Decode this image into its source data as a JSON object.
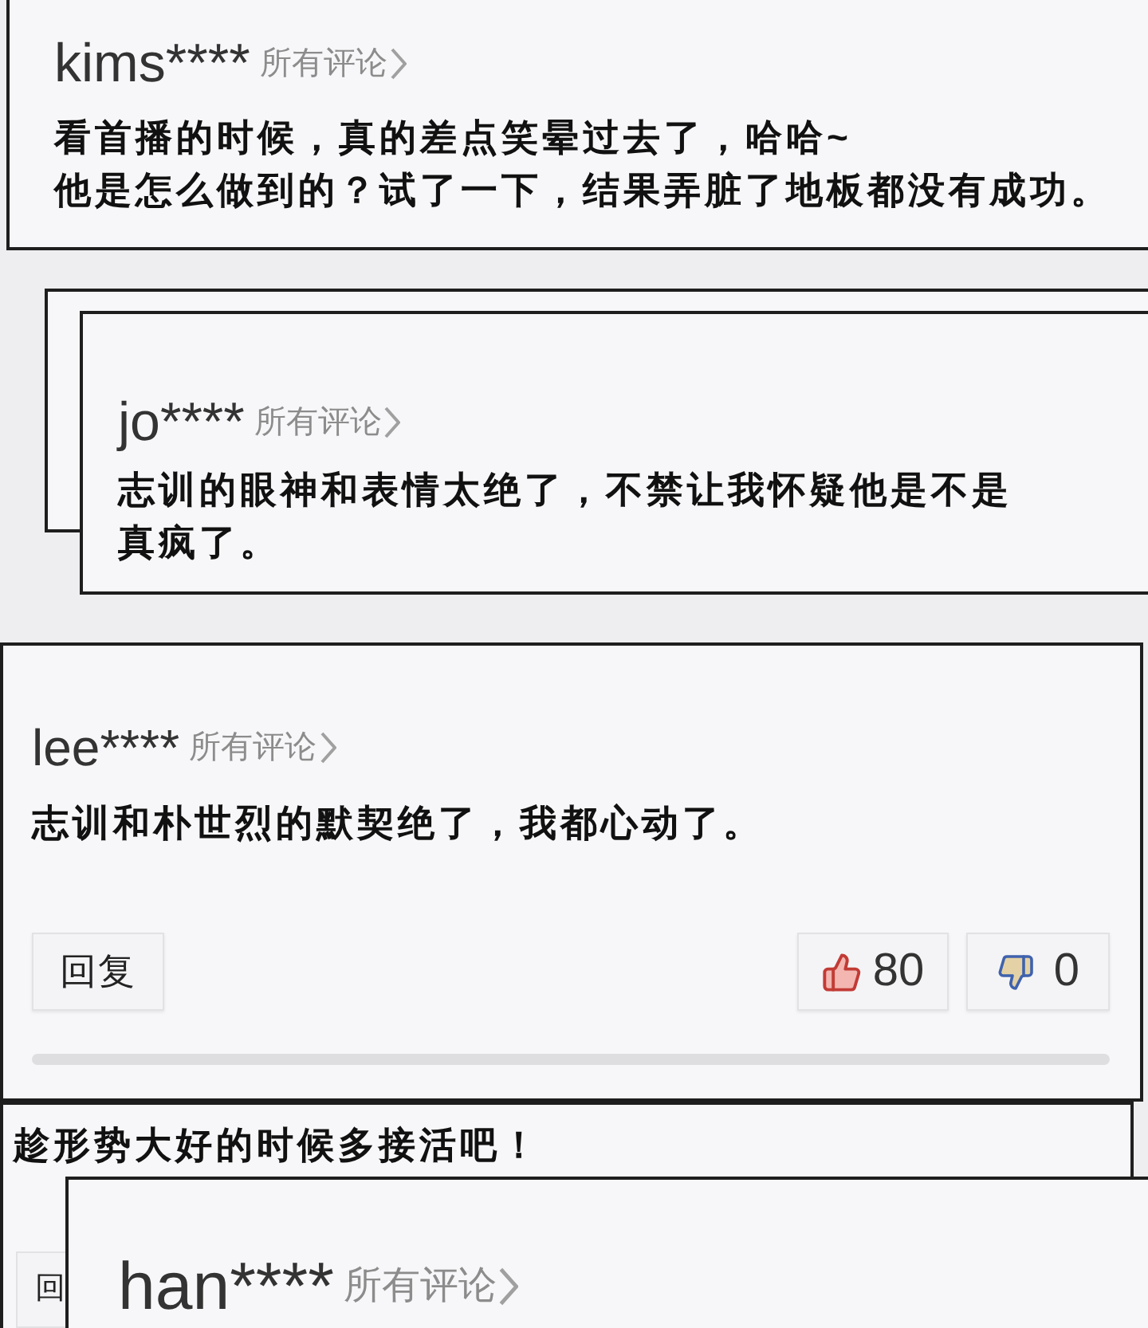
{
  "cards": [
    {
      "kind": "comment",
      "user": "kims****",
      "link": "所有评论",
      "body": [
        "看首播的时候，真的差点笑晕过去了，哈哈~",
        "他是怎么做到的？试了一下，结果弄脏了地板都没有成功。"
      ]
    },
    {
      "kind": "empty"
    },
    {
      "kind": "comment",
      "user": "jo****",
      "link": "所有评论",
      "body": [
        "志训的眼神和表情太绝了，不禁让我怀疑他是不是",
        "真疯了。"
      ]
    },
    {
      "kind": "comment",
      "user": "lee****",
      "link": "所有评论",
      "body": [
        "志训和朴世烈的默契绝了，我都心动了。"
      ],
      "reply_button": "回复",
      "likes": "80",
      "dislikes": "0"
    },
    {
      "kind": "comment",
      "body": [
        "趁形势大好的时候多接活吧！"
      ],
      "reply_button": "回"
    },
    {
      "kind": "comment",
      "user": "han****",
      "link": "所有评论"
    }
  ]
}
